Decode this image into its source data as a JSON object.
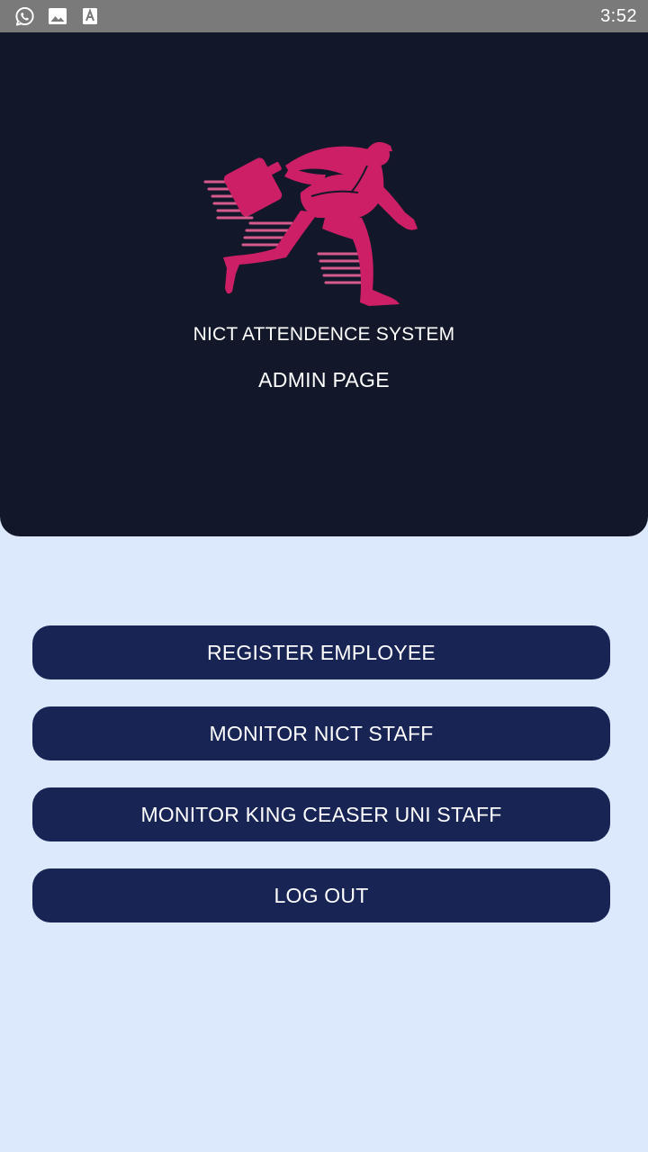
{
  "status_bar": {
    "time": "3:52",
    "icons": [
      "whatsapp-icon",
      "image-icon",
      "font-icon"
    ]
  },
  "header": {
    "logo": "running-businessman-logo",
    "app_title": "NICT ATTENDENCE SYSTEM",
    "page_subtitle": "ADMIN PAGE"
  },
  "actions": {
    "register_label": "REGISTER EMPLOYEE",
    "monitor_nict_label": "MONITOR NICT STAFF",
    "monitor_king_label": "MONITOR KING CEASER UNI STAFF",
    "logout_label": "LOG OUT"
  },
  "colors": {
    "header_bg": "#121829",
    "page_bg": "#dce9fd",
    "button_bg": "#172454",
    "logo": "#cc1f66"
  }
}
